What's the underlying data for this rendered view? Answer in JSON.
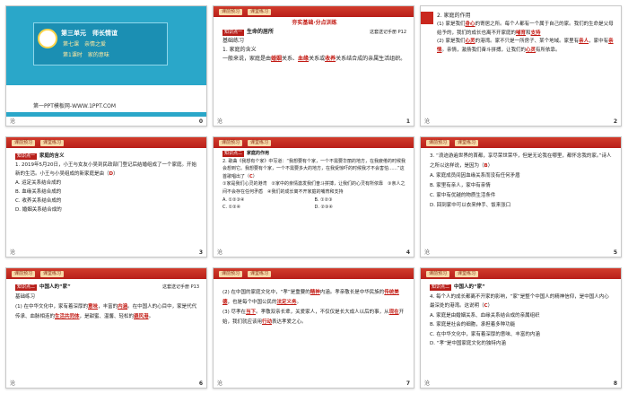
{
  "slides": [
    {
      "num": "0",
      "unit": "第三单元　师长情谊",
      "lesson": "第七课　亲情之爱",
      "period": "第1课时　家的意味",
      "url": "第一PPT模板网-WWW.1PPT.COM",
      "foot": "沧"
    },
    {
      "num": "1",
      "tab1": "课前预习",
      "tab2": "课堂练习",
      "title": "夯实基础·分点训练",
      "badge": "知识点一",
      "topic": "生命的居所",
      "ref": "这套送记手册 P12",
      "sub": "基础练习",
      "line1": "1. 家庭的含义",
      "body": "一般来说，家庭是由",
      "b1": "婚姻",
      "c1": "关系、",
      "b2": "血缘",
      "c2": "关系或",
      "b3": "收养",
      "c3": "关系结合成的亲属生活组织。",
      "foot": "沧"
    },
    {
      "num": "2",
      "tab1": "课前预习",
      "tab2": "课堂练习",
      "line1": "2. 家庭的作用",
      "p1a": "(1) 家是我们",
      "p1b": "身心",
      "p1c": "的寄居之所。每个人都有一个属于自己的家。我们的生命是父母给予的，我们的成长也离不开家庭的",
      "p1d": "哺育",
      "p1e": "和",
      "p1f": "支持",
      "p2a": "(2) 家是我们",
      "p2b": "心灵",
      "p2c": "的港湾。家不只是一所房子、某个地域。家里有",
      "p2d": "亲人",
      "p2e": "，家中有",
      "p2f": "亲情",
      "p2g": "。亲情，激扬我们奋斗拼搏，让我们的",
      "p2h": "心灵",
      "p2i": "有所依靠。",
      "foot": "沧"
    },
    {
      "num": "3",
      "tab1": "课前预习",
      "tab2": "课堂练习",
      "badge": "知识点一",
      "topic": "家庭的含义",
      "q": "1. 2019年5月20日，小王与女友小吴到民政部门登记后结婚组成了一个家庭。开始新的生活。小王与小吴组成的新家庭是由（",
      "ans": "D",
      "qend": "）",
      "opts": [
        "A. 运定关系结合成的",
        "B. 血缘关系结合成的",
        "C. 收养关系结合成的",
        "D. 婚姻关系结合成的"
      ],
      "foot": "沧"
    },
    {
      "num": "4",
      "tab1": "课前预习",
      "tab2": "课堂练习",
      "badge": "知识点二",
      "topic": "家庭的作用",
      "q": "2. 歌曲《我想有个家》中写道：“我想要有个家，一个不需要华丽的地方，在我疲倦的时候我会想到它。我想要有个家，一个不需要多大的地方，在我受惊吓的时候我才不会害怕……”这首歌唱出了（",
      "ans": "C",
      "qend": "）",
      "items": "①家是我们心灵的港湾　②家中的亲情激发我们奋斗拼搏，让我们的心灵有所依靠　③亲人之间不会存在任何矛盾　④我们的成长离不开家庭的哺育和支持",
      "opts": [
        "A. ①②③④",
        "B. ①②③",
        "C. ①②④",
        "D. ②③④"
      ],
      "foot": "沧"
    },
    {
      "num": "5",
      "tab1": "课前预习",
      "tab2": "课堂练习",
      "q": "3. “浪迹游遍世界的首都，享尽荣世荣华，但是无论我在哪里，都怀念我的家。”诗人之所以这样说，是因为（",
      "ans": "B",
      "qend": "）",
      "opts": [
        "A. 家庭成员间因血缘关系而没有任何矛盾",
        "B. 家里有亲人，家中有亲情",
        "C. 家中有优越的物质生活条件",
        "D. 回到家中可以衣来伸手、饭来张口"
      ],
      "foot": "沧"
    },
    {
      "num": "6",
      "tab1": "课前预习",
      "tab2": "课堂练习",
      "badge": "知识点二",
      "topic": "中国人的“家”",
      "ref": "这套送记手册 P13",
      "sub": "基础练习",
      "p1": "(1) 在中华文化中，家有着深厚的",
      "b1": "意味",
      "c1": "，丰富的",
      "b2": "内涵",
      "c2": "。在中国人的心目中，家是代代传承、血脉相连的",
      "b3": "生活共同体",
      "c3": "，是甜蜜、温馨、轻松的",
      "b4": "避风港",
      "c4": "。",
      "foot": "沧"
    },
    {
      "num": "7",
      "tab1": "课前预习",
      "tab2": "课堂练习",
      "p2a": "(2) 在中国的家庭文化中，“孝”是重要的",
      "p2b": "精神",
      "p2c": "内涵。孝亲敬长是中华民族的",
      "p2d": "传统美德",
      "p2e": "，也是每个中国公民的",
      "p2f": "法定义务",
      "p2g": "。",
      "p3a": "(3) 尽孝在",
      "p3b": "当下",
      "p3c": "。孝敬双亲长辈，关爱家人，不仅仅是长大成人以后的事，从",
      "p3d": "现在",
      "p3e": "开始，我们就应该用",
      "p3f": "行动",
      "p3g": "表达孝爱之心。",
      "foot": "沧"
    },
    {
      "num": "8",
      "tab1": "课前预习",
      "tab2": "课堂练习",
      "badge": "知识点二",
      "topic": "中国人的“家”",
      "q": "4. 每个人的成长都离不开家的影响，“家”是整个中国人的精神信仰，是中国人内心最深处的港湾。这说明（",
      "ans": "C",
      "qend": "）",
      "opts": [
        "A. 家庭是由婚姻关系、血缘关系结合成的亲属组织",
        "B. 家庭是社会的细胞，承担着多种功能",
        "C. 在中华文化中，家有着深厚的意味、丰富的内涵",
        "D. “孝”是中国家庭文化的独特内涵"
      ],
      "foot": "沧"
    }
  ]
}
